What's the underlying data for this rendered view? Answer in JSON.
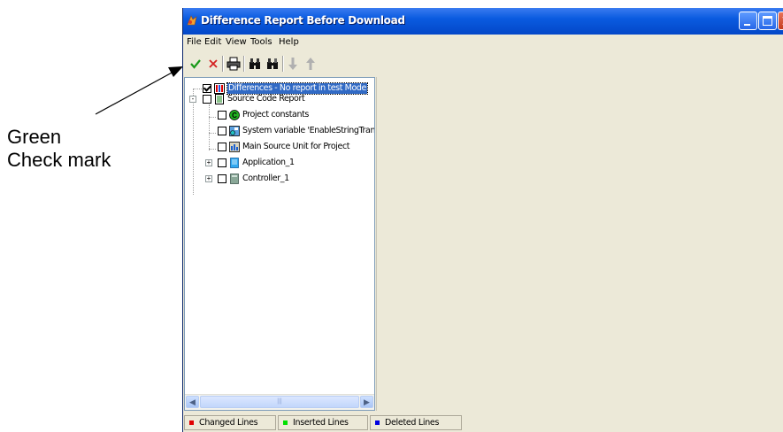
{
  "annotation": {
    "line1": "Green",
    "line2": "Check mark"
  },
  "window": {
    "title": "Difference Report Before Download"
  },
  "menu": {
    "items": [
      "File",
      "Edit",
      "View",
      "Tools",
      "Help"
    ]
  },
  "toolbar": {
    "icons": [
      "check-icon",
      "x-icon",
      "print-icon",
      "binoculars-icon",
      "binoculars-next-icon",
      "arrow-down-icon",
      "arrow-up-icon"
    ],
    "colors": {
      "check": "#1a9a1a",
      "x": "#d42020"
    }
  },
  "tree": {
    "nodes": [
      {
        "label": "Differences - No report in test Mode",
        "checked": true,
        "selected": true,
        "icon": "differences-icon"
      },
      {
        "label": "Source Code Report",
        "checked": false,
        "expander": "-",
        "icon": "document-icon"
      },
      {
        "label": "Project constants",
        "checked": false,
        "icon": "constants-icon"
      },
      {
        "label": "System variable 'EnableStringTransl",
        "checked": false,
        "icon": "system-variable-icon"
      },
      {
        "label": "Main Source Unit for Project",
        "checked": false,
        "icon": "source-unit-icon"
      },
      {
        "label": "Application_1",
        "checked": false,
        "expander": "+",
        "icon": "application-icon"
      },
      {
        "label": "Controller_1",
        "checked": false,
        "expander": "+",
        "icon": "controller-icon"
      }
    ],
    "scrollbar_thumb": "|||"
  },
  "status": {
    "legend": [
      {
        "label": "Changed Lines",
        "color": "#e00000"
      },
      {
        "label": "Inserted Lines",
        "color": "#00e000"
      },
      {
        "label": "Deleted Lines",
        "color": "#0000e0"
      }
    ]
  }
}
